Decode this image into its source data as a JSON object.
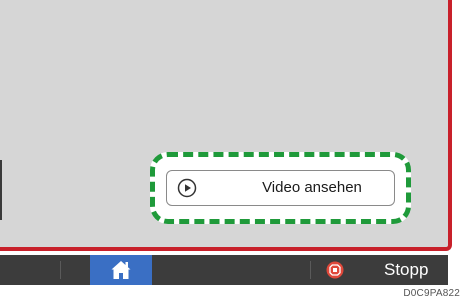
{
  "video_button": {
    "label": "Video ansehen",
    "icon": "play-circle-icon"
  },
  "taskbar": {
    "home_icon": "home-icon",
    "stop_icon": "stop-icon",
    "stop_label": "Stopp"
  },
  "image_code": "D0C9PA822",
  "colors": {
    "screen_background": "#d6d6d6",
    "frame_red": "#c8202a",
    "highlight_green": "#1f9a3a",
    "taskbar": "#3c3c3c",
    "home_active": "#3a6fc4",
    "stop_red": "#e0483a"
  }
}
